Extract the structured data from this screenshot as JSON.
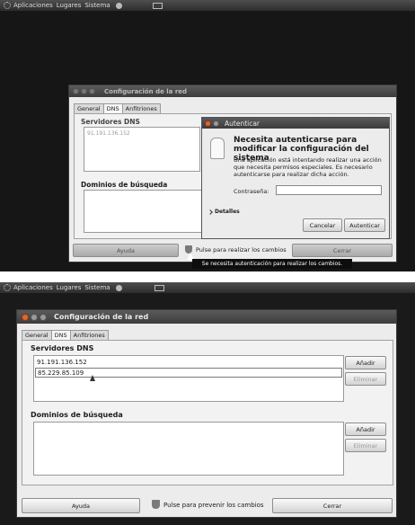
{
  "panel": {
    "menu_apps": "Aplicaciones",
    "menu_places": "Lugares",
    "menu_system": "Sistema"
  },
  "network_window": {
    "title": "Configuración de la red",
    "tabs": [
      "General",
      "DNS",
      "Anfitriones"
    ],
    "dns_servers_label": "Servidores DNS",
    "search_domains_label": "Dominios de búsqueda",
    "help_button": "Ayuda",
    "close_button": "Cerrar",
    "add_button": "Añadir",
    "delete_button": "Eliminar"
  },
  "screen_locked": {
    "dns_servers": [
      "91.191.136.152"
    ],
    "unlock_text": "Pulse para realizar los cambios",
    "tooltip": "Se necesita autenticación para realizar los cambios."
  },
  "auth_dialog": {
    "title": "Autenticar",
    "heading": "Necesita autenticarse para modificar la configuración del sistema",
    "message": "Una aplicación está intentando realizar una acción que necesita permisos especiales. Es necesario autenticarse para realizar dicha acción.",
    "password_label": "Contraseña:",
    "password_value": "",
    "details_label": "Detalles",
    "cancel_button": "Cancelar",
    "authenticate_button": "Autenticar"
  },
  "screen_unlocked": {
    "dns_servers": [
      "91.191.136.152",
      "85.229.85.109"
    ],
    "lock_text": "Pulse para prevenir los cambios"
  }
}
